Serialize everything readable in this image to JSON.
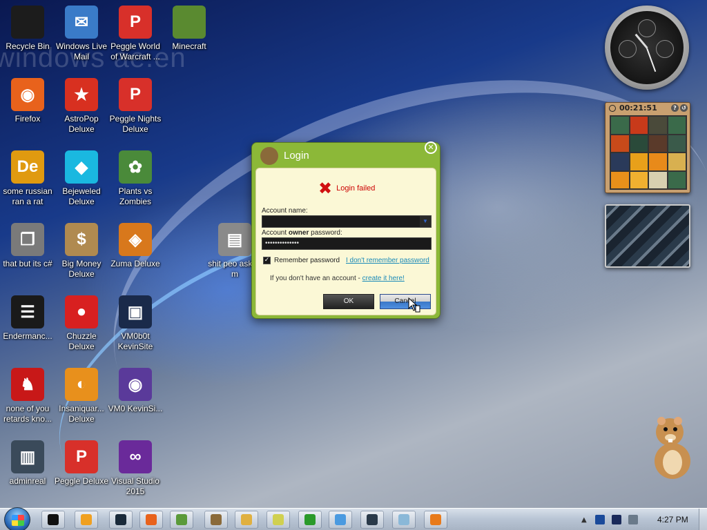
{
  "wallpaper_text": "windows ae.en",
  "desktop_icons": [
    {
      "label": "Recycle Bin",
      "glyph": "",
      "icon": "recycle-bin-icon",
      "color": "#1c1c1c"
    },
    {
      "label": "Windows Live Mail",
      "glyph": "✉",
      "icon": "mail-icon",
      "color": "#3a7bc8"
    },
    {
      "label": "Peggle World of Warcraft ...",
      "glyph": "P",
      "icon": "peggle-icon",
      "color": "#d8302a"
    },
    {
      "label": "Minecraft",
      "glyph": "",
      "icon": "grass-block-icon",
      "color": "#5a8a30"
    },
    {
      "label": "Firefox",
      "glyph": "◉",
      "icon": "firefox-icon",
      "color": "#e8621c"
    },
    {
      "label": "AstroPop Deluxe",
      "glyph": "★",
      "icon": "astropop-icon",
      "color": "#d83020"
    },
    {
      "label": "Peggle Nights Deluxe",
      "glyph": "P",
      "icon": "peggle-nights-icon",
      "color": "#d8302a"
    },
    {
      "label": "some russian ran a rat",
      "glyph": "De",
      "icon": "de-icon",
      "color": "#e09a10"
    },
    {
      "label": "Bejeweled Deluxe",
      "glyph": "◆",
      "icon": "gem-icon",
      "color": "#1ab8e0"
    },
    {
      "label": "Plants vs Zombies",
      "glyph": "✿",
      "icon": "flower-icon",
      "color": "#4a8a3a"
    },
    {
      "label": "that but its c#",
      "glyph": "❐",
      "icon": "copy-icon",
      "color": "#7a7a7a"
    },
    {
      "label": "Big Money Deluxe",
      "glyph": "$",
      "icon": "money-bag-icon",
      "color": "#b08a50"
    },
    {
      "label": "Zuma Deluxe",
      "glyph": "◈",
      "icon": "zuma-icon",
      "color": "#d8781c"
    },
    {
      "label": "shit peo asked m",
      "glyph": "▤",
      "icon": "folder-icon",
      "color": "#8a8a8a"
    },
    {
      "label": "Endermanc...",
      "glyph": "☰",
      "icon": "terminal-icon",
      "color": "#1a1a1a"
    },
    {
      "label": "Chuzzle Deluxe",
      "glyph": "●",
      "icon": "chuzzle-icon",
      "color": "#d82020"
    },
    {
      "label": "VM0b0t KevinSite",
      "glyph": "▣",
      "icon": "server-icon",
      "color": "#1a2a4a"
    },
    {
      "label": "none of you retards kno...",
      "glyph": "♞",
      "icon": "dragon-icon",
      "color": "#c81818"
    },
    {
      "label": "Insaniquar... Deluxe",
      "glyph": "◐",
      "icon": "fish-icon",
      "color": "#e8901c"
    },
    {
      "label": "VM0 KevinSi...",
      "glyph": "◉",
      "icon": "firefox-doc-icon",
      "color": "#5a3a9a"
    },
    {
      "label": "adminreal",
      "glyph": "▥",
      "icon": "exe-icon",
      "color": "#3a4a5a"
    },
    {
      "label": "Peggle Deluxe",
      "glyph": "P",
      "icon": "peggle-deluxe-icon",
      "color": "#d8302a"
    },
    {
      "label": "Visual Studio 2015",
      "glyph": "∞",
      "icon": "visual-studio-icon",
      "color": "#6a2a9a"
    }
  ],
  "gadgets": {
    "puzzle_timer": "00:21:51"
  },
  "dialog": {
    "title": "Login",
    "close_glyph": "✕",
    "error_glyph": "✖",
    "error": "Login failed",
    "account_label": "Account name:",
    "password_label_pre": "Account ",
    "password_label_bold": "owner",
    "password_label_post": " password:",
    "account_value": "",
    "password_value": "••••••••••••••",
    "remember_label": "Remember password",
    "remember_checked": true,
    "forgot_link": "I don't remember password",
    "register_text": "If you don't have an account - ",
    "register_link": "create it here!",
    "ok_label": "OK",
    "cancel_label": "Cancel"
  },
  "taskbar": {
    "buttons": [
      {
        "icon": "black-app-icon",
        "color": "#111"
      },
      {
        "icon": "media-player-icon",
        "color": "#f0a020"
      },
      {
        "icon": "steam-icon",
        "color": "#1a2a3a"
      },
      {
        "icon": "firefox-icon",
        "color": "#e8621c"
      },
      {
        "icon": "users-icon",
        "color": "#5a9a3a"
      },
      {
        "icon": "hamster-icon",
        "color": "#8a6a3a"
      },
      {
        "icon": "windows-explorer-icon",
        "color": "#e0b040"
      },
      {
        "icon": "notepad-icon",
        "color": "#d0d050"
      },
      {
        "icon": "h-app-icon",
        "color": "#2a9a2a"
      },
      {
        "icon": "messenger-icon",
        "color": "#4a9ae0"
      },
      {
        "icon": "monitor-icon",
        "color": "#2a3a4a"
      },
      {
        "icon": "document-icon",
        "color": "#8ab8d8"
      },
      {
        "icon": "orange-ball-icon",
        "color": "#e87a1a"
      }
    ],
    "clock": "4:27 PM"
  }
}
